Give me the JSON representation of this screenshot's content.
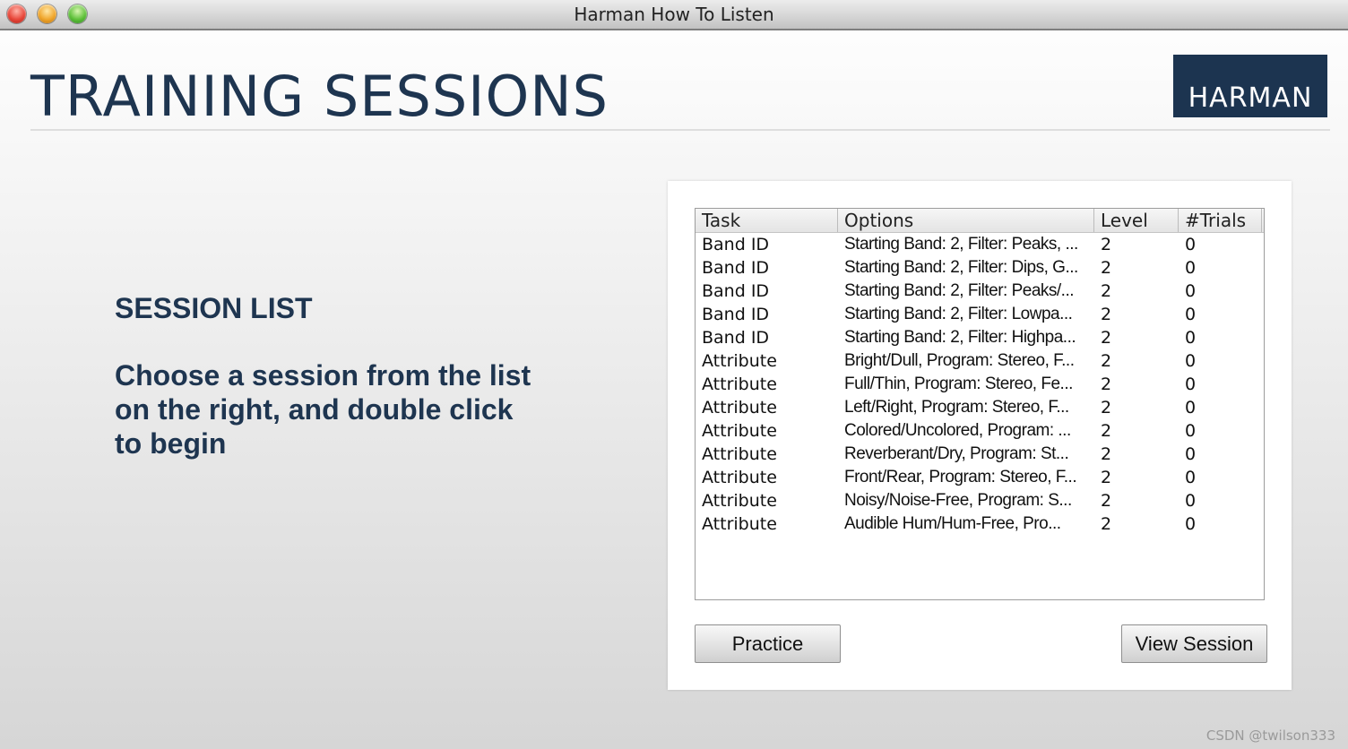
{
  "window": {
    "title": "Harman How To Listen"
  },
  "header": {
    "title": "TRAINING SESSIONS",
    "logo_text": "HARMAN"
  },
  "left": {
    "heading": "SESSION LIST",
    "instructions": "Choose a session from the list on the right, and double click to begin"
  },
  "table": {
    "columns": [
      "Task",
      "Options",
      "Level",
      "#Trials"
    ],
    "rows": [
      [
        "Band ID",
        "Starting Band: 2, Filter: Peaks, ...",
        "2",
        "0"
      ],
      [
        "Band ID",
        "Starting Band: 2, Filter: Dips, G...",
        "2",
        "0"
      ],
      [
        "Band ID",
        "Starting Band: 2, Filter: Peaks/...",
        "2",
        "0"
      ],
      [
        "Band ID",
        "Starting Band: 2, Filter: Lowpa...",
        "2",
        "0"
      ],
      [
        "Band ID",
        "Starting Band: 2, Filter: Highpa...",
        "2",
        "0"
      ],
      [
        "Attribute",
        "Bright/Dull, Program: Stereo, F...",
        "2",
        "0"
      ],
      [
        "Attribute",
        "Full/Thin, Program: Stereo, Fe...",
        "2",
        "0"
      ],
      [
        "Attribute",
        "Left/Right, Program: Stereo, F...",
        "2",
        "0"
      ],
      [
        "Attribute",
        "Colored/Uncolored, Program: ...",
        "2",
        "0"
      ],
      [
        "Attribute",
        "Reverberant/Dry, Program: St...",
        "2",
        "0"
      ],
      [
        "Attribute",
        "Front/Rear, Program: Stereo, F...",
        "2",
        "0"
      ],
      [
        "Attribute",
        "Noisy/Noise-Free, Program: S...",
        "2",
        "0"
      ],
      [
        "Attribute",
        "Audible Hum/Hum-Free, Pro...",
        "2",
        "0"
      ]
    ]
  },
  "buttons": {
    "practice": "Practice",
    "view_session": "View Session"
  },
  "watermark": "CSDN @twilson333"
}
